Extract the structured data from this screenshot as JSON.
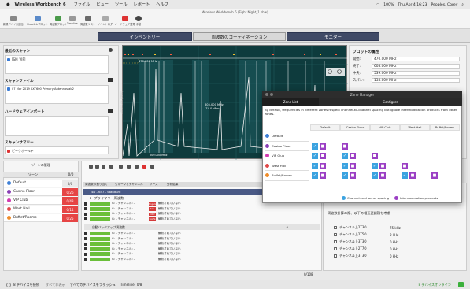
{
  "menubar": {
    "app_name": "Wireless Workbench 6",
    "menus": [
      "ファイル",
      "ビュー",
      "ツール",
      "レポート",
      "ヘルプ"
    ],
    "status": "100%",
    "datetime": "Thu Apr 4 16:23",
    "user": "Peoples, Corey"
  },
  "window": {
    "title": "Wireless Workbench 6 (Fight Night_1.shw)"
  },
  "toolbar": {
    "items": [
      "新規デバイス追加",
      "Showlinkプロット",
      "周波数プロット",
      "Timeline",
      "周波数リスト",
      "イベントログ",
      "ハードウェア発見",
      "手動"
    ]
  },
  "modetabs": [
    "インベントリー",
    "周波数のコーディネーション",
    "モニター"
  ],
  "leftpanel": {
    "scan_heading": "最近のスキャン",
    "scan_item": "[SM_VIP]",
    "scanfile_heading": "スキャンファイル",
    "scanfile_item": "07 Mar 2019 AXT600 Primary Antennas.ab2",
    "hw_heading": "ハードウェアインポート",
    "summary_heading": "スキャンサマリー",
    "summary_item": "ピークホールド"
  },
  "spectrum": {
    "freq_left": "470.000 MHz",
    "freq_mid": "605.000 MHz",
    "freq_mid2": "-74.0 dBm",
    "freq_bottom": "500.000 MHz",
    "freq_bottom2": "600.000 MHz",
    "ylabel": "Amplitude (dBm)"
  },
  "props": {
    "heading": "プロットの属性",
    "rows": [
      {
        "label": "開始:",
        "value": "470.000 MHz"
      },
      {
        "label": "終了:",
        "value": "608.000 MHz"
      },
      {
        "label": "中央:",
        "value": "539.000 MHz"
      },
      {
        "label": "スパン:",
        "value": "138.000 MHz"
      }
    ]
  },
  "zones": {
    "header": "ゾーンの管理",
    "col_name": "ゾーン",
    "col_count": "0/0",
    "items": [
      {
        "name": "Default",
        "count": "0/0",
        "color": "#3e7fd6",
        "count_bg": "#e9e9e9",
        "count_fg": "#333"
      },
      {
        "name": "Casino Floor",
        "count": "0/26",
        "color": "#8a3fb5",
        "count_bg": "#e64545",
        "count_fg": "#fff"
      },
      {
        "name": "VIP Club",
        "count": "0/43",
        "color": "#d23bb0",
        "count_bg": "#e64545",
        "count_fg": "#fff"
      },
      {
        "name": "West Hall",
        "count": "0/14",
        "color": "#e04848",
        "count_bg": "#e64545",
        "count_fg": "#fff"
      },
      {
        "name": "Buffet/Rooms",
        "count": "0/25",
        "color": "#ef8c2a",
        "count_bg": "#e64545",
        "count_fg": "#fff"
      }
    ]
  },
  "channels": {
    "columns": [
      "周波数の割り当て",
      "グループとチャンネル",
      "ソース",
      "分析結果"
    ],
    "group_row": "4D - 657 - Standard",
    "group_count": "2730",
    "primary_label": "プライマリー周波数",
    "backup_label": "自動バックアップ周波数",
    "backup_count": "0",
    "rows": [
      {
        "ch": "G: - チャンネル: -",
        "tag": "Angela",
        "tag_color": "#d43a3a",
        "status": "解析されていない"
      },
      {
        "ch": "G: - チャンネル: -",
        "tag": "Ana",
        "tag_color": "#d43a3a",
        "status": "解析されていない"
      },
      {
        "ch": "G: - チャンネル: -",
        "tag": "ODE",
        "tag_color": "#d43a3a",
        "status": "解析されていない"
      },
      {
        "ch": "G: - チャンネル: -",
        "tag": "Lisha",
        "tag_color": "#d43a3a",
        "status": "解析されていない"
      },
      {
        "ch": "G: - チャンネル: -",
        "tag": "",
        "tag_color": "",
        "status": "解析されていない"
      },
      {
        "ch": "G: - チャンネル: -",
        "tag": "",
        "tag_color": "",
        "status": "解析されていない"
      },
      {
        "ch": "G: - チャンネル: -",
        "tag": "",
        "tag_color": "",
        "status": "解析されていない"
      },
      {
        "ch": "G: - チャンネル: -",
        "tag": "",
        "tag_color": "",
        "status": "解析されていない"
      },
      {
        "ch": "G: - チャンネル: -",
        "tag": "",
        "tag_color": "",
        "status": "解析されていない"
      },
      {
        "ch": "G: - チャンネル: -",
        "tag": "",
        "tag_color": "",
        "status": "解析されていない"
      }
    ],
    "footer": "0/108"
  },
  "lowright": {
    "heading": "周波数計算の際、以下の相互変調積を考慮",
    "items": [
      {
        "label": "チャンネル上2T3O",
        "value": "75 kHz"
      },
      {
        "label": "チャンネル上2T5O",
        "value": "0 kHz"
      },
      {
        "label": "チャンネル上3T3O",
        "value": "0 kHz"
      },
      {
        "label": "チャンネル上2T7O",
        "value": "0 kHz"
      },
      {
        "label": "チャンネル上3T3O",
        "value": "0 kHz"
      }
    ]
  },
  "dialog": {
    "title": "Zone Manager",
    "tabs": [
      "Zone List",
      "Configure"
    ],
    "description": "By default, frequencies in different zones respect channel-to-channel spacing but ignore intermodulation products from other zones.",
    "columns": [
      "Default",
      "Casino Floor",
      "VIP Club",
      "West Hall",
      "Buffet/Rooms"
    ],
    "rows": [
      "Default",
      "Casino Floor",
      "VIP Club",
      "West Hall",
      "Buffet/Rooms"
    ],
    "legend_spacing": "Channel-to-channel spacing",
    "legend_imd": "Intermodulation products"
  },
  "statusbar": {
    "devices": "8 デバイスを接続",
    "all_hide": "すべて非表示",
    "flash": "すべてのデバイスをフラッシュ",
    "timeline": "Timeline",
    "timeline_val": "0/8",
    "online": "8 デバイスオンライン"
  }
}
